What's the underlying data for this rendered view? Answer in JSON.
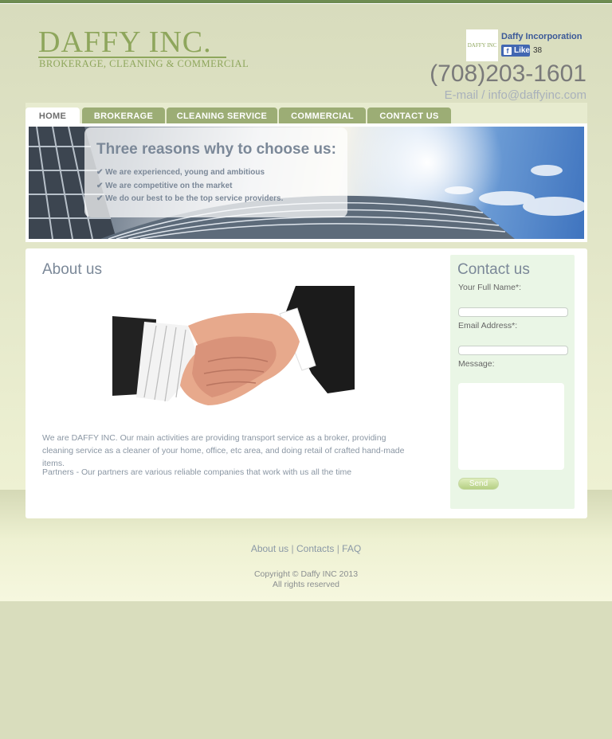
{
  "brand": {
    "name": "DAFFY INC.",
    "tagline": "BROKERAGE, CLEANING & COMMERCIAL",
    "mini_logo": "DAFFY INC"
  },
  "facebook": {
    "page_name": "Daffy Incorporation",
    "like_label": "Like",
    "like_count": "38",
    "icon": "facebook-f-icon"
  },
  "contact_header": {
    "phone": "(708)203-1601",
    "email": "E-mail / info@daffyinc.com"
  },
  "nav": {
    "tabs": [
      {
        "label": "HOME",
        "active": true
      },
      {
        "label": "BROKERAGE"
      },
      {
        "label": "CLEANING SERVICE"
      },
      {
        "label": "COMMERCIAL"
      },
      {
        "label": "CONTACT US"
      }
    ]
  },
  "banner": {
    "title": "Three reasons why to choose us:",
    "check_mark": "✔",
    "reasons": [
      "We are experienced, young and ambitious",
      "We are competitive on the market",
      "We do our best to be the top service providers."
    ]
  },
  "about": {
    "title": "About us",
    "image": "handshake-image",
    "paragraph1": "We are DAFFY INC. Our main activities are providing transport service as a broker, providing cleaning service as a cleaner of your home, office, etc area, and doing retail of crafted hand-made items.",
    "paragraph2": "Partners - Our partners are various reliable companies that work with us all the time"
  },
  "contact_form": {
    "title": "Contact us",
    "name_label": "Your Full Name*:",
    "email_label": "Email Address*:",
    "message_label": "Message:",
    "send_label": "Send"
  },
  "footer": {
    "links": [
      "About us",
      "Contacts",
      "FAQ"
    ],
    "separator": "|",
    "copyright": "Copyright © Daffy INC 2013",
    "rights": "All rights reserved"
  },
  "colors": {
    "accent_green": "#8ea65c",
    "tab_green": "#9cad75",
    "text_slate": "#7b8898",
    "facebook_blue": "#4267b2"
  }
}
